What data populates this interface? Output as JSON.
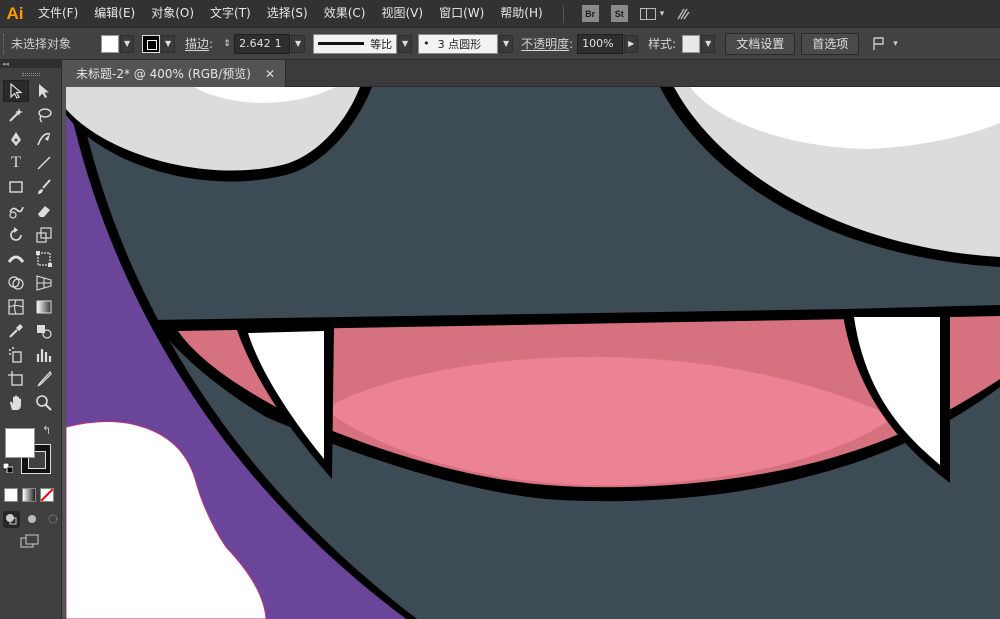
{
  "app": {
    "logo": "Ai"
  },
  "menubar": {
    "items": [
      "文件(F)",
      "编辑(E)",
      "对象(O)",
      "文字(T)",
      "选择(S)",
      "效果(C)",
      "视图(V)",
      "窗口(W)",
      "帮助(H)"
    ],
    "bridge_label": "Br",
    "stock_label": "St"
  },
  "controlbar": {
    "selection_status": "未选择对象",
    "stroke_label": "描边",
    "stroke_weight": "2.642",
    "stroke_unit": "1",
    "profile_label": "等比",
    "brush_label": "3 点圆形",
    "brush_bullet": "•",
    "opacity_label": "不透明度",
    "opacity_value": "100%",
    "style_label": "样式",
    "doc_setup_label": "文档设置",
    "preferences_label": "首选项"
  },
  "toolbar": {
    "collapse_glyph": "◂◂",
    "swap_glyph": "↰"
  },
  "document": {
    "tab_title": "未标题-2* @ 400% (RGB/预览)",
    "close_glyph": "✕"
  },
  "colors": {
    "purple_bg": "#6a4599",
    "face": "#3d4b54",
    "eye_white": "#dcdcdc",
    "mouth_pink": "#d6717f",
    "tongue": "#eb8395",
    "outline": "#000000",
    "fang": "#ffffff"
  }
}
